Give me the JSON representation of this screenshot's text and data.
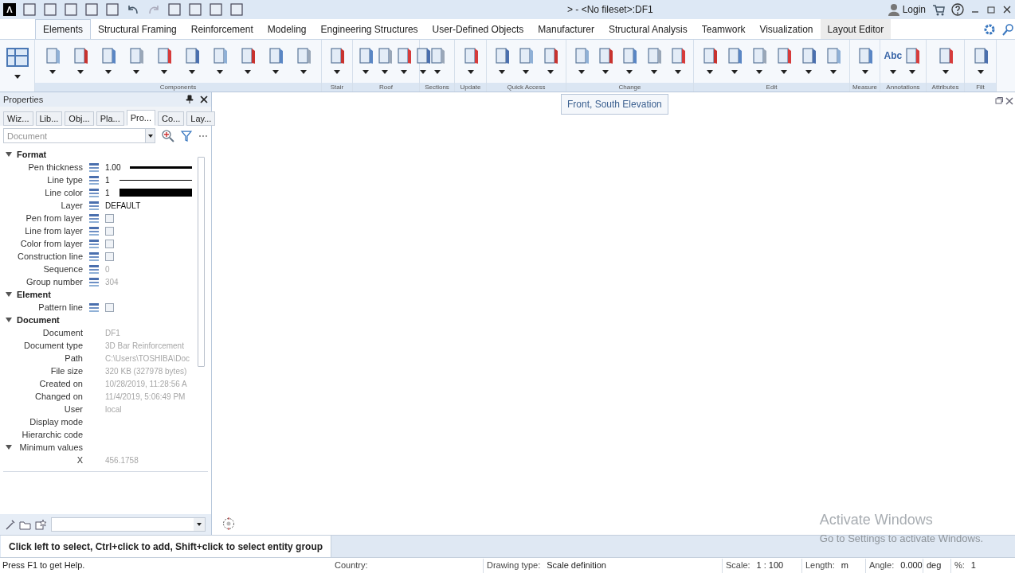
{
  "title_bar": {
    "app_menu": "Λ",
    "title": "> - <No fileset>:DF1",
    "login": "Login"
  },
  "tabs": [
    {
      "label": "Elements",
      "selected": true
    },
    {
      "label": "Structural Framing",
      "selected": false
    },
    {
      "label": "Reinforcement",
      "selected": false
    },
    {
      "label": "Modeling",
      "selected": false
    },
    {
      "label": "Engineering Structures",
      "selected": false
    },
    {
      "label": "User-Defined Objects",
      "selected": false
    },
    {
      "label": "Manufacturer",
      "selected": false
    },
    {
      "label": "Structural Analysis",
      "selected": false
    },
    {
      "label": "Teamwork",
      "selected": false
    },
    {
      "label": "Visualization",
      "selected": false
    },
    {
      "label": "Layout Editor",
      "selected": false,
      "highlighted": true
    }
  ],
  "ribbon_groups": [
    {
      "label": "Components"
    },
    {
      "label": "Stair"
    },
    {
      "label": "Roof"
    },
    {
      "label": "Sections"
    },
    {
      "label": "Update"
    },
    {
      "label": "Quick Access"
    },
    {
      "label": "Change"
    },
    {
      "label": "Edit"
    },
    {
      "label": "Measure"
    },
    {
      "label": "Annotations",
      "text_icon": "Abc"
    },
    {
      "label": "Attributes"
    },
    {
      "label": "Filt"
    }
  ],
  "properties_panel": {
    "title": "Properties",
    "tabs": [
      {
        "label": "Wiz...",
        "selected": false
      },
      {
        "label": "Lib...",
        "selected": false
      },
      {
        "label": "Obj...",
        "selected": false
      },
      {
        "label": "Pla...",
        "selected": false
      },
      {
        "label": "Pro...",
        "selected": true
      },
      {
        "label": "Co...",
        "selected": false
      },
      {
        "label": "Lay...",
        "selected": false
      }
    ],
    "filter_placeholder": "Document",
    "rows": [
      {
        "kind": "section",
        "label": "Format",
        "expanded": true
      },
      {
        "kind": "prop",
        "label": "Pen thickness",
        "value": "1.00",
        "sample": {
          "kind": "thick"
        }
      },
      {
        "kind": "prop",
        "label": "Line type",
        "value": "1",
        "sample": {
          "kind": "thin"
        }
      },
      {
        "kind": "prop",
        "label": "Line color",
        "value": "1",
        "sample": {
          "kind": "bar"
        }
      },
      {
        "kind": "prop",
        "label": "Layer",
        "value": "DEFAULT"
      },
      {
        "kind": "check",
        "label": "Pen from layer",
        "checked": false
      },
      {
        "kind": "check",
        "label": "Line from layer",
        "checked": false
      },
      {
        "kind": "check",
        "label": "Color from layer",
        "checked": false
      },
      {
        "kind": "check",
        "label": "Construction line",
        "checked": false
      },
      {
        "kind": "prop",
        "label": "Sequence",
        "value": "0",
        "muted": true
      },
      {
        "kind": "prop",
        "label": "Group number",
        "value": "304",
        "muted": true
      },
      {
        "kind": "section",
        "label": "Element",
        "expanded": true
      },
      {
        "kind": "check",
        "label": "Pattern line",
        "checked": false
      },
      {
        "kind": "section",
        "label": "Document",
        "expanded": true
      },
      {
        "kind": "prop",
        "label": "Document",
        "value": "DF1",
        "muted": true
      },
      {
        "kind": "prop",
        "label": "Document type",
        "value": "3D Bar Reinforcement",
        "muted": true
      },
      {
        "kind": "prop",
        "label": "Path",
        "value": "C:\\Users\\TOSHIBA\\Doc",
        "muted": true
      },
      {
        "kind": "prop",
        "label": "File size",
        "value": "320 KB (327978 bytes)",
        "muted": true
      },
      {
        "kind": "prop",
        "label": "Created on",
        "value": "10/28/2019, 11:28:56 A",
        "muted": true
      },
      {
        "kind": "prop",
        "label": "Changed on",
        "value": "11/4/2019, 5:06:49 PM",
        "muted": true
      },
      {
        "kind": "prop",
        "label": "User",
        "value": "local",
        "muted": true
      },
      {
        "kind": "prop",
        "label": "Display mode"
      },
      {
        "kind": "prop",
        "label": "Hierarchic code"
      },
      {
        "kind": "prop",
        "label": "Minimum values",
        "expanded": true
      },
      {
        "kind": "prop",
        "label": "X",
        "value": "456.1758",
        "muted": true
      }
    ]
  },
  "view_tooltip": "Front, South Elevation",
  "prompt": "Click left to select, Ctrl+click to add, Shift+click to select entity group",
  "watermark": {
    "title": "Activate Windows",
    "subtitle": "Go to Settings to activate Windows."
  },
  "status_bar": {
    "help": "Press F1 to get Help.",
    "fields": [
      {
        "label": "Country:"
      },
      {
        "label": "Drawing type:",
        "value": "Scale definition"
      },
      {
        "label": "Scale:",
        "value": "1 : 100"
      },
      {
        "label": "Length:",
        "value": "m"
      },
      {
        "label": "Angle:",
        "value": "0.000"
      },
      {
        "value": "deg"
      },
      {
        "label": "%:",
        "value": "1"
      }
    ]
  }
}
